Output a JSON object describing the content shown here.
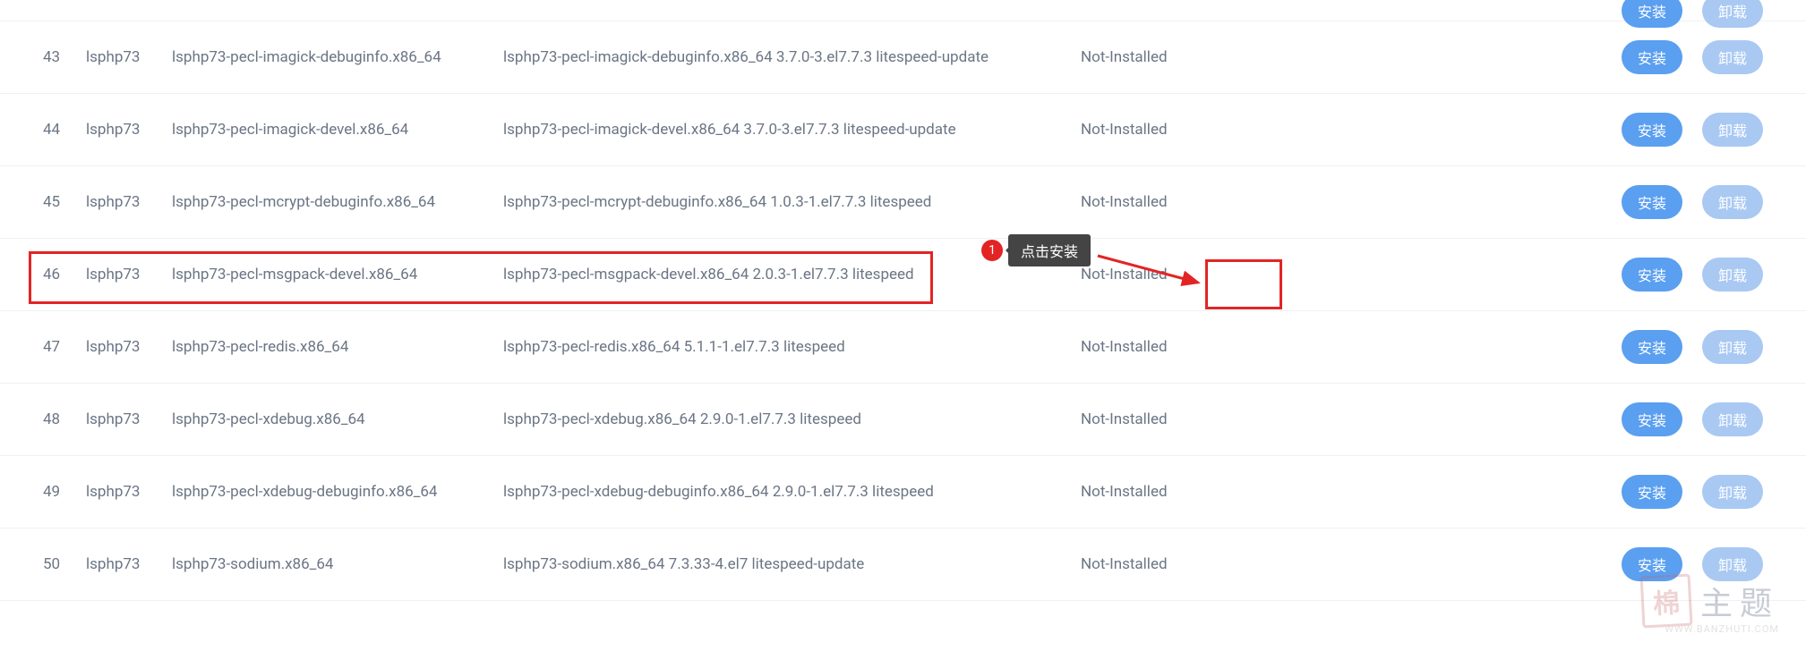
{
  "buttons": {
    "install": "安装",
    "uninstall": "卸载"
  },
  "tooltip": {
    "badge": "1",
    "text": "点击安装"
  },
  "watermark": {
    "box": "棉",
    "text": "主题",
    "url": "WWW.BANZHUTI.COM"
  },
  "rows": [
    {
      "idx": "43",
      "pkg": "lsphp73",
      "name": "lsphp73-pecl-imagick-debuginfo.x86_64",
      "desc": "lsphp73-pecl-imagick-debuginfo.x86_64 3.7.0-3.el7.7.3 litespeed-update",
      "status": "Not-Installed"
    },
    {
      "idx": "44",
      "pkg": "lsphp73",
      "name": "lsphp73-pecl-imagick-devel.x86_64",
      "desc": "lsphp73-pecl-imagick-devel.x86_64 3.7.0-3.el7.7.3 litespeed-update",
      "status": "Not-Installed"
    },
    {
      "idx": "45",
      "pkg": "lsphp73",
      "name": "lsphp73-pecl-mcrypt-debuginfo.x86_64",
      "desc": "lsphp73-pecl-mcrypt-debuginfo.x86_64 1.0.3-1.el7.7.3 litespeed",
      "status": "Not-Installed"
    },
    {
      "idx": "46",
      "pkg": "lsphp73",
      "name": "lsphp73-pecl-msgpack-devel.x86_64",
      "desc": "lsphp73-pecl-msgpack-devel.x86_64 2.0.3-1.el7.7.3 litespeed",
      "status": "Not-Installed"
    },
    {
      "idx": "47",
      "pkg": "lsphp73",
      "name": "lsphp73-pecl-redis.x86_64",
      "desc": "lsphp73-pecl-redis.x86_64 5.1.1-1.el7.7.3 litespeed",
      "status": "Not-Installed"
    },
    {
      "idx": "48",
      "pkg": "lsphp73",
      "name": "lsphp73-pecl-xdebug.x86_64",
      "desc": "lsphp73-pecl-xdebug.x86_64 2.9.0-1.el7.7.3 litespeed",
      "status": "Not-Installed"
    },
    {
      "idx": "49",
      "pkg": "lsphp73",
      "name": "lsphp73-pecl-xdebug-debuginfo.x86_64",
      "desc": "lsphp73-pecl-xdebug-debuginfo.x86_64 2.9.0-1.el7.7.3 litespeed",
      "status": "Not-Installed"
    },
    {
      "idx": "50",
      "pkg": "lsphp73",
      "name": "lsphp73-sodium.x86_64",
      "desc": "lsphp73-sodium.x86_64 7.3.33-4.el7 litespeed-update",
      "status": "Not-Installed"
    }
  ]
}
